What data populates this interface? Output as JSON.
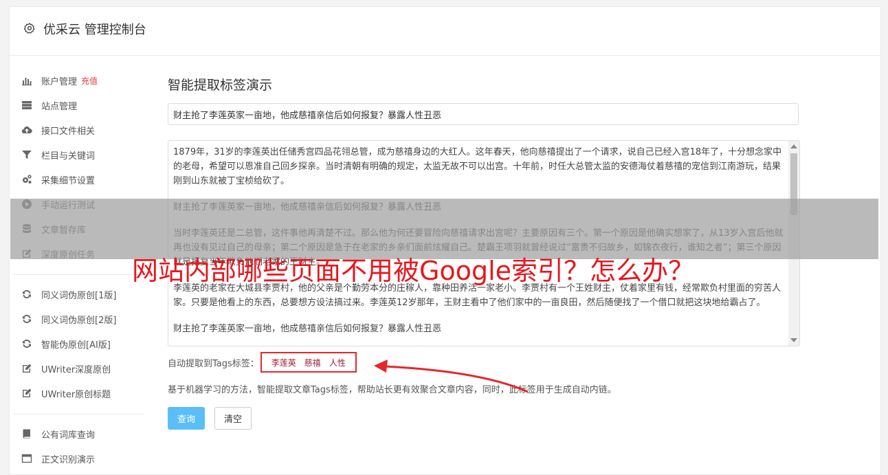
{
  "header": {
    "title": "优采云 管理控制台"
  },
  "sidebar": {
    "group1": [
      {
        "label": "账户管理",
        "extra": "充值",
        "icon": "bar-chart-icon"
      },
      {
        "label": "站点管理",
        "icon": "server-icon"
      },
      {
        "label": "接口文件相关",
        "icon": "cloud-upload-icon"
      },
      {
        "label": "栏目与关键词",
        "icon": "filter-icon"
      },
      {
        "label": "采集细节设置",
        "icon": "cogs-icon"
      },
      {
        "label": "手动运行测试",
        "icon": "play-circle-icon"
      },
      {
        "label": "文章暂存库",
        "icon": "database-icon"
      },
      {
        "label": "深度原创任务",
        "icon": "edit-icon"
      }
    ],
    "group2": [
      {
        "label": "同义词伪原创[1版]",
        "icon": "refresh-icon"
      },
      {
        "label": "同义词伪原创[2版]",
        "icon": "refresh-icon"
      },
      {
        "label": "智能伪原创[AI版]",
        "icon": "refresh-icon"
      },
      {
        "label": "UWriter深度原创",
        "icon": "edit-icon"
      },
      {
        "label": "UWriter原创标题",
        "icon": "edit-icon"
      }
    ],
    "group3": [
      {
        "label": "公有词库查询",
        "icon": "book-icon"
      },
      {
        "label": "正文识别演示",
        "icon": "window-icon"
      }
    ]
  },
  "main": {
    "title": "智能提取标签演示",
    "title_value": "财主抢了李莲英家一亩地，他成慈禧亲信后如何报复？暴露人性丑恶",
    "content_paragraphs": [
      "1879年，31岁的李莲英出任储秀宫四品花翎总管，成为慈禧身边的大红人。这年春天，他向慈禧提出了一个请求，说自己已经入宫18年了，十分想念家中的老母，希望可以恩准自己回乡探亲。当时清朝有明确的规定，太监无故不可以出宫。十年前，时任大总管太监的安德海仗着慈禧的宠信到江南游玩，结果刚到山东就被丁宝桢给砍了。",
      "财主抢了李莲英家一亩地，他成慈禧亲信后如何报复？暴露人性丑恶",
      "当时李莲英还是二总管，这件事他再清楚不过。那么他为何还要冒险向慈禧请求出宫呢？主要原因有三个。第一个原因是他确实想家了，从13岁入宫后他就再也没有见过自己的母亲；第二个原因是急于在老家的乡亲们面前炫耀自己。楚霸王项羽就曾经说过“富贵不归故乡，如锦衣夜行，谁知之者”；第三个原因就是报复当年欺负他们老家的王财主。",
      "李莲英的老家在大城县李贾村，他的父亲是个勤劳本分的庄稼人，靠种田养活一家老小。李贾村有一个王姓财主，仗着家里有钱，经常欺负村里面的穷苦人家。只要是他看上的东西，总要想方设法搞过来。李莲英12岁那年，王财主看中了他们家中的一亩良田，然后随便找了一个借口就把这块地给霸占了。",
      "财主抢了李莲英家一亩地，他成慈禧亲信后如何报复？暴露人性丑恶"
    ],
    "tags_label": "自动提取到Tags标签：",
    "tags": [
      "李莲英",
      "慈禧",
      "人性"
    ],
    "description": "基于机器学习的方法，智能提取文章Tags标签，帮助站长更有效聚合文章内容，同时，此标签用于生成自动内链。",
    "query_button": "查询",
    "clear_button": "清空"
  },
  "overlay": {
    "headline": "网站内部哪些页面不用被Google索引？怎么办？"
  },
  "colors": {
    "accent": "#5bbef6",
    "danger": "#e4393c",
    "headline": "#e8161d",
    "tag_text": "#a0192e"
  }
}
